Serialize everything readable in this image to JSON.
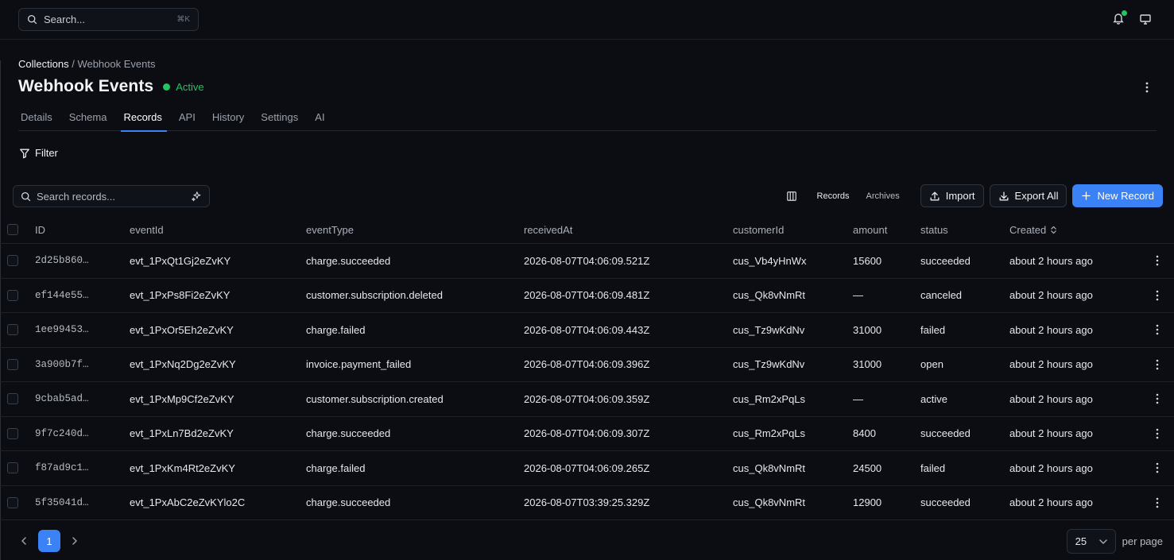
{
  "topbar": {
    "search_placeholder": "Search...",
    "search_shortcut": "⌘K",
    "notification_dot_color": "#22c55e"
  },
  "breadcrumb": {
    "root": "Collections",
    "separator": " / ",
    "current": "Webhook Events"
  },
  "header": {
    "title": "Webhook Events",
    "status": "Active",
    "status_color": "#22c55e"
  },
  "tabs": [
    {
      "label": "Details"
    },
    {
      "label": "Schema"
    },
    {
      "label": "Records",
      "active": true
    },
    {
      "label": "API"
    },
    {
      "label": "History"
    },
    {
      "label": "Settings"
    },
    {
      "label": "AI"
    }
  ],
  "filter_label": "Filter",
  "toolbar": {
    "search_placeholder": "Search records...",
    "records_label": "Records",
    "archives_label": "Archives",
    "import_label": "Import",
    "export_label": "Export All",
    "new_record_label": "New Record",
    "accent_color": "#3b82f6"
  },
  "table": {
    "columns": [
      "ID",
      "eventId",
      "eventType",
      "receivedAt",
      "customerId",
      "amount",
      "status",
      "Created"
    ],
    "rows": [
      {
        "id": "2d25b860…",
        "eventId": "evt_1PxQt1Gj2eZvKY",
        "eventType": "charge.succeeded",
        "receivedAt": "2026-08-07T04:06:09.521Z",
        "customerId": "cus_Vb4yHnWx",
        "amount": "15600",
        "status": "succeeded",
        "created": "about 2 hours ago"
      },
      {
        "id": "ef144e55…",
        "eventId": "evt_1PxPs8Fi2eZvKY",
        "eventType": "customer.subscription.deleted",
        "receivedAt": "2026-08-07T04:06:09.481Z",
        "customerId": "cus_Qk8vNmRt",
        "amount": "—",
        "status": "canceled",
        "created": "about 2 hours ago"
      },
      {
        "id": "1ee99453…",
        "eventId": "evt_1PxOr5Eh2eZvKY",
        "eventType": "charge.failed",
        "receivedAt": "2026-08-07T04:06:09.443Z",
        "customerId": "cus_Tz9wKdNv",
        "amount": "31000",
        "status": "failed",
        "created": "about 2 hours ago"
      },
      {
        "id": "3a900b7f…",
        "eventId": "evt_1PxNq2Dg2eZvKY",
        "eventType": "invoice.payment_failed",
        "receivedAt": "2026-08-07T04:06:09.396Z",
        "customerId": "cus_Tz9wKdNv",
        "amount": "31000",
        "status": "open",
        "created": "about 2 hours ago"
      },
      {
        "id": "9cbab5ad…",
        "eventId": "evt_1PxMp9Cf2eZvKY",
        "eventType": "customer.subscription.created",
        "receivedAt": "2026-08-07T04:06:09.359Z",
        "customerId": "cus_Rm2xPqLs",
        "amount": "—",
        "status": "active",
        "created": "about 2 hours ago"
      },
      {
        "id": "9f7c240d…",
        "eventId": "evt_1PxLn7Bd2eZvKY",
        "eventType": "charge.succeeded",
        "receivedAt": "2026-08-07T04:06:09.307Z",
        "customerId": "cus_Rm2xPqLs",
        "amount": "8400",
        "status": "succeeded",
        "created": "about 2 hours ago"
      },
      {
        "id": "f87ad9c1…",
        "eventId": "evt_1PxKm4Rt2eZvKY",
        "eventType": "charge.failed",
        "receivedAt": "2026-08-07T04:06:09.265Z",
        "customerId": "cus_Qk8vNmRt",
        "amount": "24500",
        "status": "failed",
        "created": "about 2 hours ago"
      },
      {
        "id": "5f35041d…",
        "eventId": "evt_1PxAbC2eZvKYlo2C",
        "eventType": "charge.succeeded",
        "receivedAt": "2026-08-07T03:39:25.329Z",
        "customerId": "cus_Qk8vNmRt",
        "amount": "12900",
        "status": "succeeded",
        "created": "about 2 hours ago"
      }
    ]
  },
  "pagination": {
    "current_page": "1",
    "per_page_value": "25",
    "per_page_label": "per page"
  }
}
